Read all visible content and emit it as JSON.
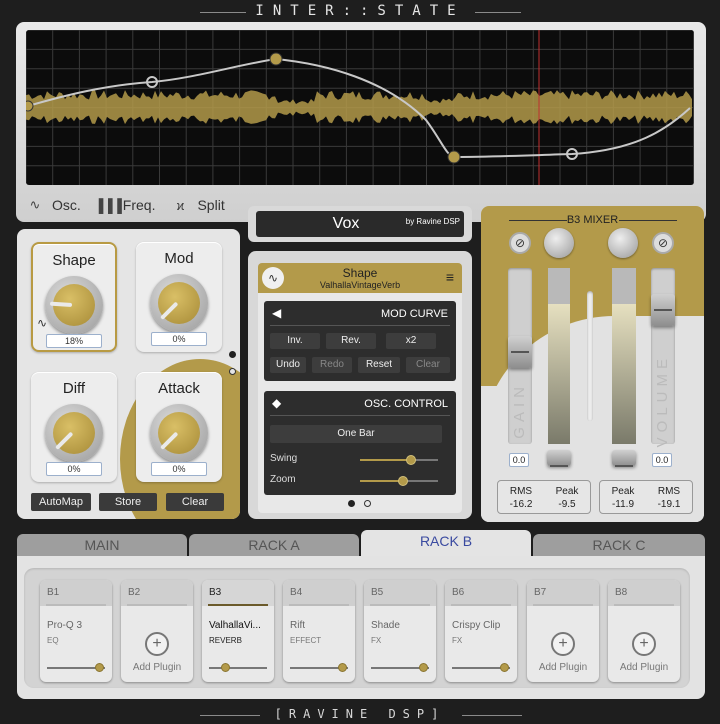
{
  "app": {
    "title": "INTER::STATE",
    "footer": "[RAVINE DSP]"
  },
  "colors": {
    "accent": "#b39a4a",
    "panel": "#e5e5e5",
    "dark": "#2d2d2d",
    "tab_active_text": "#3a4aa0",
    "playhead": "#c03030"
  },
  "graph": {
    "tabs": [
      {
        "icon": "sine-wave-icon",
        "label": "Osc."
      },
      {
        "icon": "bars-icon",
        "label": "Freq."
      },
      {
        "icon": "split-icon",
        "label": "Split"
      }
    ]
  },
  "knobs": [
    {
      "label": "Shape",
      "value": "18%",
      "level": 0.18,
      "selected": true
    },
    {
      "label": "Mod",
      "value": "0%",
      "level": 0.0,
      "selected": false
    },
    {
      "label": "Diff",
      "value": "0%",
      "level": 0.0,
      "selected": false
    },
    {
      "label": "Attack",
      "value": "0%",
      "level": 0.0,
      "selected": false
    }
  ],
  "knob_actions": {
    "automap": "AutoMap",
    "store": "Store",
    "clear": "Clear"
  },
  "preset": {
    "name": "Vox",
    "by": "by Ravine DSP"
  },
  "device": {
    "title": "Shape",
    "subtitle": "ValhallaVintageVerb",
    "mod_curve": {
      "header": "MOD CURVE",
      "buttons": [
        "Inv.",
        "Rev.",
        "x2",
        "Undo",
        "Redo",
        "Reset",
        "Clear"
      ]
    },
    "osc_control": {
      "header": "OSC. CONTROL",
      "mode": "One Bar",
      "swing_label": "Swing",
      "swing": 0.65,
      "zoom_label": "Zoom",
      "zoom": 0.55
    }
  },
  "mixer": {
    "title": "B3 MIXER",
    "gain_label": "GAIN",
    "volume_label": "VOLUME",
    "gain_value": "0.0",
    "volume_value": "0.0",
    "stats": [
      {
        "label": "RMS",
        "value": "-16.2"
      },
      {
        "label": "Peak",
        "value": "-9.5"
      },
      {
        "label": "Peak",
        "value": "-11.9"
      },
      {
        "label": "RMS",
        "value": "-19.1"
      }
    ]
  },
  "tabs": [
    {
      "label": "MAIN",
      "active": false
    },
    {
      "label": "RACK A",
      "active": false
    },
    {
      "label": "RACK B",
      "active": true
    },
    {
      "label": "RACK C",
      "active": false
    }
  ],
  "slots": [
    {
      "id": "B1",
      "name": "Pro-Q 3",
      "type": "EQ",
      "empty": false,
      "active": false,
      "level": 0.92
    },
    {
      "id": "B2",
      "empty": true,
      "add_label": "Add Plugin"
    },
    {
      "id": "B3",
      "name": "ValhallaVi...",
      "type": "REVERB",
      "empty": false,
      "active": true,
      "level": 0.3
    },
    {
      "id": "B4",
      "name": "Rift",
      "type": "EFFECT",
      "empty": false,
      "active": false,
      "level": 0.92
    },
    {
      "id": "B5",
      "name": "Shade",
      "type": "FX",
      "empty": false,
      "active": false,
      "level": 0.92
    },
    {
      "id": "B6",
      "name": "Crispy Clip",
      "type": "FX",
      "empty": false,
      "active": false,
      "level": 0.92
    },
    {
      "id": "B7",
      "empty": true,
      "add_label": "Add Plugin"
    },
    {
      "id": "B8",
      "empty": true,
      "add_label": "Add Plugin"
    }
  ]
}
